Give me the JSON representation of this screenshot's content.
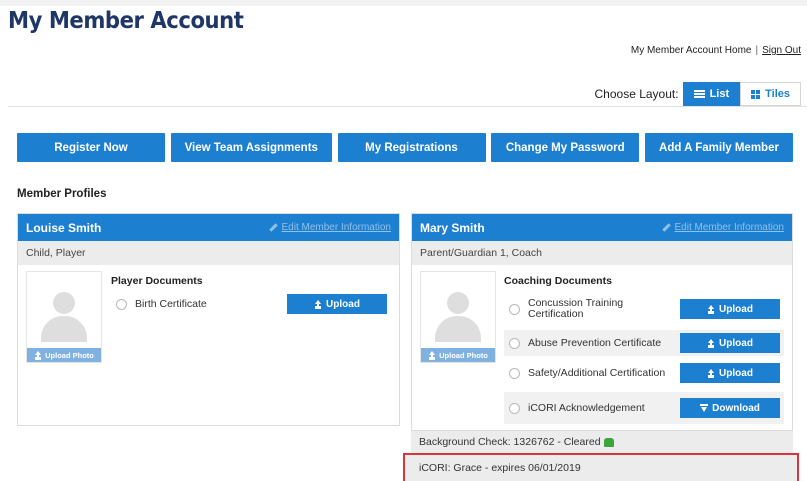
{
  "page": {
    "title": "My Member Account"
  },
  "account_links": {
    "home": "My Member Account Home",
    "separator": "|",
    "sign_out": "Sign Out"
  },
  "layout": {
    "label": "Choose Layout:",
    "list": "List",
    "tiles": "Tiles",
    "selected": "List"
  },
  "actions": [
    "Register Now",
    "View Team Assignments",
    "My Registrations",
    "Change My Password",
    "Add A Family Member"
  ],
  "profiles_heading": "Member Profiles",
  "profiles": [
    {
      "name": "Louise Smith",
      "edit": "Edit Member Information",
      "role": "Child, Player",
      "upload_photo": "Upload Photo",
      "documents_title": "Player Documents",
      "documents": [
        {
          "label": "Birth Certificate",
          "button": "Upload",
          "icon": "upload-icon"
        }
      ]
    },
    {
      "name": "Mary Smith",
      "edit": "Edit Member Information",
      "role": "Parent/Guardian 1, Coach",
      "upload_photo": "Upload Photo",
      "documents_title": "Coaching Documents",
      "documents": [
        {
          "label": "Concussion Training Certification",
          "button": "Upload",
          "icon": "upload-icon"
        },
        {
          "label": "Abuse Prevention Certificate",
          "button": "Upload",
          "icon": "upload-icon"
        },
        {
          "label": "Safety/Additional Certification",
          "button": "Upload",
          "icon": "upload-icon"
        },
        {
          "label": "iCORI Acknowledgement",
          "button": "Download",
          "icon": "download-icon"
        }
      ],
      "background_check": "Background Check: 1326762 - Cleared",
      "icori": "iCORI: Grace - expires 06/01/2019"
    }
  ],
  "colors": {
    "primary": "#1c7fd0",
    "title": "#1f3767",
    "highlight_border": "#d8363c",
    "cleared": "#3aa53a"
  }
}
